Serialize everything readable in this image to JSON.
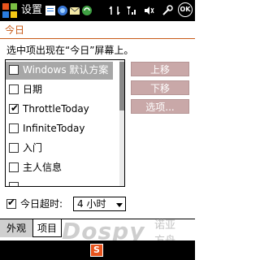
{
  "statusbar": {
    "title": "设置",
    "ok_label": "OK",
    "tray_icons": [
      "notes-icon",
      "network-icon",
      "sync-icon",
      "connectivity-icon",
      "signal-icon",
      "volume-icon",
      "tools-icon"
    ]
  },
  "header": {
    "page_title": "今日"
  },
  "instruction": "选中项出现在“今日”屏幕上。",
  "list": {
    "items": [
      {
        "label": "Windows 默认方案",
        "checked": false,
        "selected": true
      },
      {
        "label": "日期",
        "checked": false,
        "selected": false
      },
      {
        "label": "ThrottleToday",
        "checked": true,
        "selected": false
      },
      {
        "label": "InfiniteToday",
        "checked": false,
        "selected": false
      },
      {
        "label": "入门",
        "checked": false,
        "selected": false
      },
      {
        "label": "主人信息",
        "checked": false,
        "selected": false
      },
      {
        "label": "",
        "checked": false,
        "selected": false
      }
    ]
  },
  "buttons": {
    "move_up": "上移",
    "move_down": "下移",
    "options": "选项..."
  },
  "timeout": {
    "checked": true,
    "check_glyph": "✔",
    "label": "今日超时:",
    "selected_value": "4 小时"
  },
  "tabs": [
    {
      "label": "外观",
      "active": false
    },
    {
      "label": "项目",
      "active": true
    }
  ],
  "watermark": {
    "brand": "Dospy",
    "cn_line1": "诺亚",
    "cn_line2": "方舟"
  },
  "bottom_bar": {
    "ime_label": "S"
  },
  "colors": {
    "accent": "#c85a17",
    "button_bg": "#c9a8a8",
    "selected_row": "#a7a7a7"
  }
}
